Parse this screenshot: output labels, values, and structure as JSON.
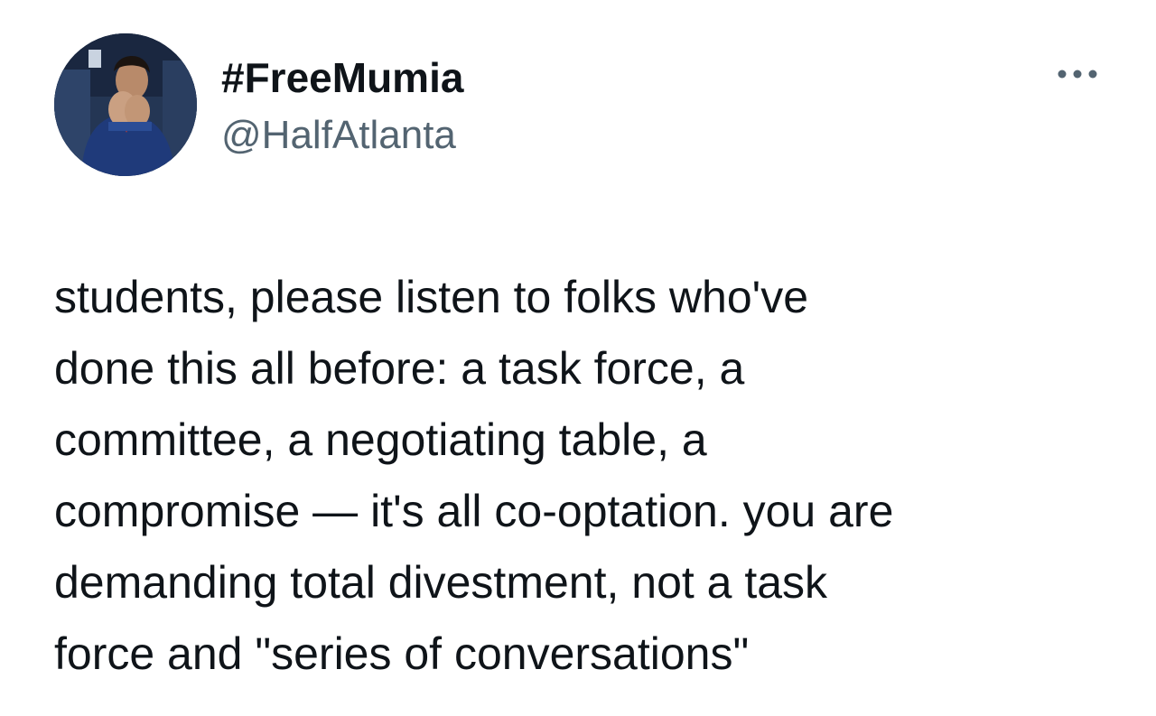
{
  "tweet": {
    "author": {
      "display_name": "#FreeMumia",
      "handle": "@HalfAtlanta",
      "avatar_icon": "profile-photo"
    },
    "more_icon": "more-horizontal-icon",
    "text": "students, please listen to folks who've\ndone this all before: a task force, a\ncommittee, a negotiating table, a\ncompromise — it's all co-optation. you are\ndemanding total divestment, not a task\nforce and \"series of conversations\""
  },
  "colors": {
    "text_primary": "#0f1419",
    "text_secondary": "#536471",
    "background": "#ffffff"
  }
}
